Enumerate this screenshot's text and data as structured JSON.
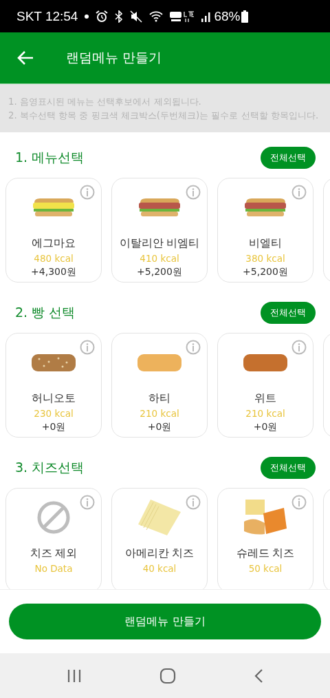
{
  "status_bar": {
    "carrier_time": "SKT 12:54",
    "battery": "68%"
  },
  "header": {
    "title": "랜덤메뉴 만들기"
  },
  "notice": [
    "1. 음영표시된 메뉴는 선택후보에서 제외됩니다.",
    "2. 복수선택 항목 중 핑크색 체크박스(두번체크)는 필수로 선택할 항목입니다."
  ],
  "sections": [
    {
      "title": "1. 메뉴선택",
      "select_all": "전체선택",
      "items": [
        {
          "kind": "sandwich-egg",
          "name": "에그마요",
          "kcal": "480 kcal",
          "price": "+4,300원"
        },
        {
          "kind": "sandwich-meat",
          "name": "이탈리안 비엠티",
          "kcal": "410 kcal",
          "price": "+5,200원"
        },
        {
          "kind": "sandwich-meat",
          "name": "비엘티",
          "kcal": "380 kcal",
          "price": "+5,200원"
        }
      ]
    },
    {
      "title": "2. 빵 선택",
      "select_all": "전체선택",
      "items": [
        {
          "kind": "bread-grain",
          "name": "허니오토",
          "kcal": "230 kcal",
          "price": "+0원"
        },
        {
          "kind": "bread-white",
          "name": "하티",
          "kcal": "210 kcal",
          "price": "+0원"
        },
        {
          "kind": "bread-wheat",
          "name": "위트",
          "kcal": "210 kcal",
          "price": "+0원"
        }
      ]
    },
    {
      "title": "3. 치즈선택",
      "select_all": "전체선택",
      "items": [
        {
          "kind": "none",
          "name": "치즈 제외",
          "kcal": "No Data"
        },
        {
          "kind": "cheese-slices",
          "name": "아메리칸 치즈",
          "kcal": "40 kcal"
        },
        {
          "kind": "cheese-mix",
          "name": "슈레드 치즈",
          "kcal": "50 kcal"
        }
      ]
    }
  ],
  "action_button": "랜덤메뉴 만들기"
}
